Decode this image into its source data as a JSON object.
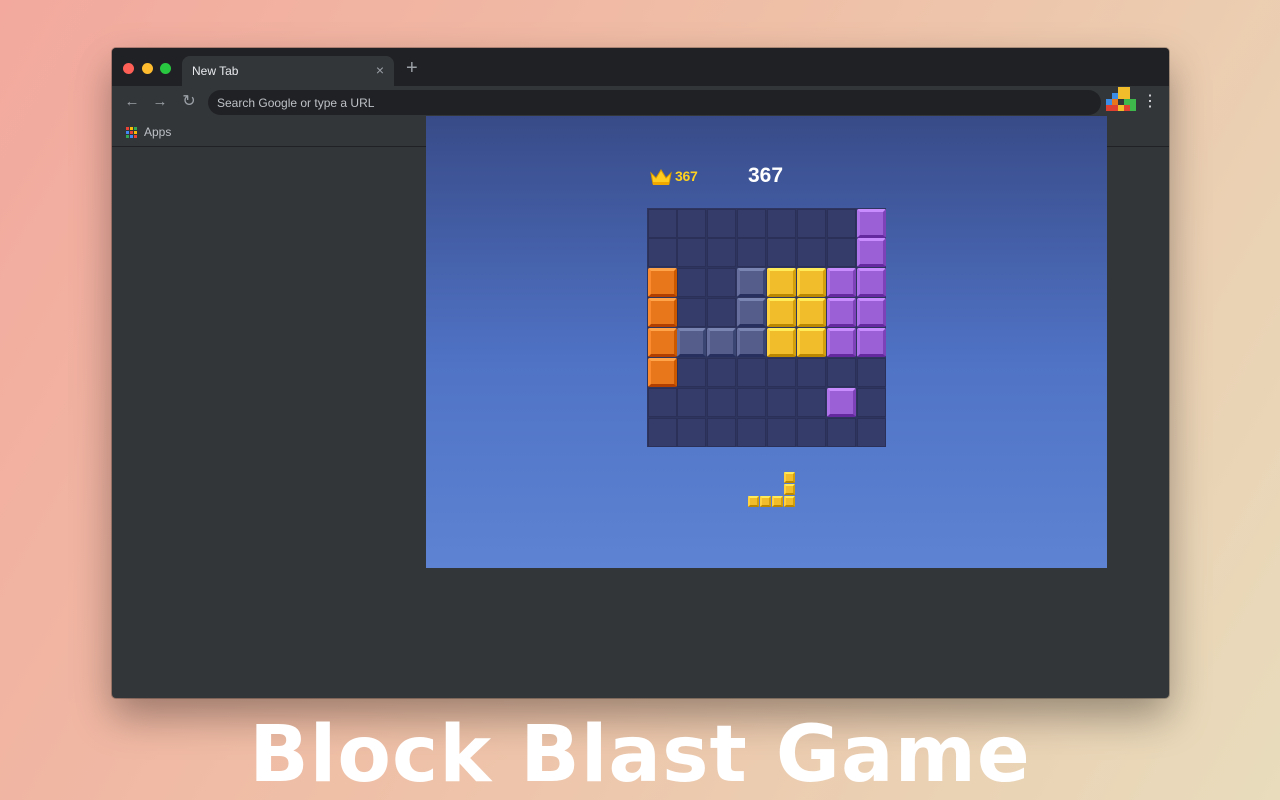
{
  "browser": {
    "tab_title": "New Tab",
    "tab_close": "×",
    "new_tab": "+",
    "omnibox_placeholder": "Search Google or type a URL",
    "bookmark_apps": "Apps",
    "nav_back": "←",
    "nav_forward": "→",
    "nav_reload": "↻",
    "menu": "⋮",
    "extension_icon": "block-blast-extension-icon",
    "window_controls": {
      "close": "#fe5f57",
      "minimize": "#febc2e",
      "maximize": "#28c840"
    }
  },
  "game": {
    "best_score": "367",
    "current_score": "367",
    "board_size": 8,
    "colors": {
      "orange": "#e8771c",
      "yellow": "#f2bd2b",
      "purple": "#9b5fd6",
      "ghost": "#5c6694",
      "empty": "#363c69"
    },
    "grid": [
      ".......P",
      ".......P",
      "O..GYYPP",
      "O..GYYPP",
      "OGGGYYPP",
      "O.......",
      "......P.",
      "........"
    ],
    "next_piece": {
      "color": "yellow",
      "cells": [
        [
          3,
          0
        ],
        [
          3,
          1
        ],
        [
          0,
          2
        ],
        [
          1,
          2
        ],
        [
          2,
          2
        ],
        [
          3,
          2
        ]
      ]
    }
  },
  "headline": "Block Blast Game"
}
